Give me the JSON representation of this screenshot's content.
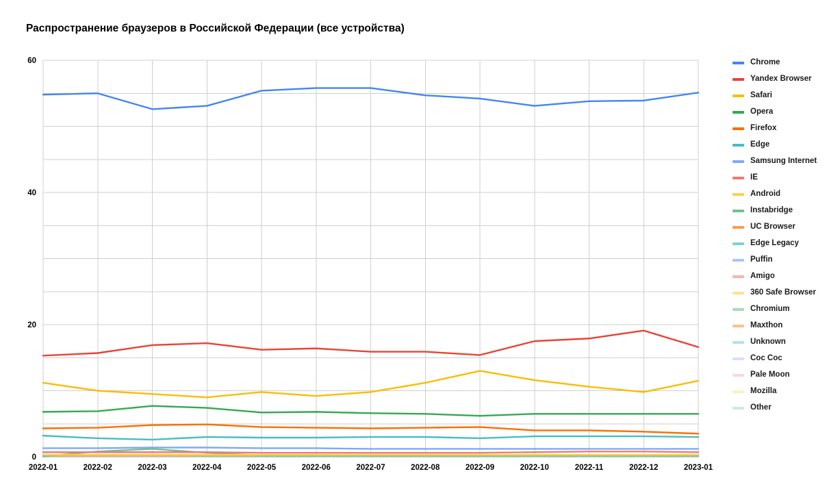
{
  "chart_data": {
    "type": "line",
    "title": "Распространение браузеров в Российской Федерации (все устройства)",
    "xlabel": "",
    "ylabel": "",
    "x": [
      "2022-01",
      "2022-02",
      "2022-03",
      "2022-04",
      "2022-05",
      "2022-06",
      "2022-07",
      "2022-08",
      "2022-09",
      "2022-10",
      "2022-11",
      "2022-12",
      "2023-01"
    ],
    "ylim": [
      0,
      60
    ],
    "yticks": [
      0,
      20,
      40,
      60
    ],
    "ytick_labels": [
      "0",
      "20",
      "40",
      "60"
    ],
    "grid": true,
    "grid_minor_step": 5,
    "legend_position": "right",
    "series": [
      {
        "name": "Chrome",
        "color": "#4285f4",
        "values": [
          54.8,
          55.0,
          52.6,
          53.1,
          55.4,
          55.8,
          55.8,
          54.7,
          54.2,
          53.1,
          53.8,
          53.9,
          55.1
        ]
      },
      {
        "name": "Yandex Browser",
        "color": "#ea4335",
        "values": [
          15.3,
          15.7,
          16.9,
          17.2,
          16.2,
          16.4,
          15.9,
          15.9,
          15.4,
          17.5,
          17.9,
          19.1,
          16.6
        ]
      },
      {
        "name": "Safari",
        "color": "#fbbc04",
        "values": [
          11.2,
          10.0,
          9.5,
          9.0,
          9.8,
          9.2,
          9.8,
          11.2,
          13.0,
          11.6,
          10.6,
          9.8,
          11.5
        ]
      },
      {
        "name": "Opera",
        "color": "#34a853",
        "values": [
          6.8,
          6.9,
          7.7,
          7.4,
          6.7,
          6.8,
          6.6,
          6.5,
          6.2,
          6.5,
          6.5,
          6.5,
          6.5
        ]
      },
      {
        "name": "Firefox",
        "color": "#ff6d01",
        "values": [
          4.3,
          4.4,
          4.8,
          4.9,
          4.5,
          4.4,
          4.3,
          4.4,
          4.5,
          4.0,
          4.0,
          3.8,
          3.5
        ]
      },
      {
        "name": "Edge",
        "color": "#46bdc6",
        "values": [
          3.2,
          2.8,
          2.6,
          3.0,
          2.9,
          2.9,
          3.0,
          3.0,
          2.8,
          3.1,
          3.1,
          3.1,
          3.0
        ]
      },
      {
        "name": "Samsung Internet",
        "color": "#7baaf7",
        "values": [
          1.3,
          1.3,
          1.4,
          1.4,
          1.3,
          1.3,
          1.2,
          1.2,
          1.2,
          1.2,
          1.2,
          1.2,
          1.2
        ]
      },
      {
        "name": "IE",
        "color": "#f07b72",
        "values": [
          0.7,
          0.7,
          0.7,
          0.7,
          0.6,
          0.6,
          0.6,
          0.6,
          0.6,
          0.7,
          0.8,
          0.8,
          0.7
        ]
      },
      {
        "name": "Android",
        "color": "#fcd04f",
        "values": [
          0.3,
          0.3,
          0.3,
          0.3,
          0.3,
          0.3,
          0.3,
          0.3,
          0.3,
          0.3,
          0.3,
          0.3,
          0.3
        ]
      },
      {
        "name": "Instabridge",
        "color": "#71c287",
        "values": [
          0.1,
          0.8,
          1.2,
          0.6,
          0.2,
          0.2,
          0.2,
          0.2,
          0.2,
          0.2,
          0.2,
          0.2,
          0.2
        ]
      },
      {
        "name": "UC Browser",
        "color": "#ff994d",
        "values": [
          0.2,
          0.2,
          0.2,
          0.2,
          0.2,
          0.2,
          0.2,
          0.2,
          0.2,
          0.2,
          0.2,
          0.2,
          0.2
        ]
      },
      {
        "name": "Edge Legacy",
        "color": "#7bd1d8",
        "values": [
          0.2,
          0.2,
          0.2,
          0.1,
          0.1,
          0.1,
          0.1,
          0.1,
          0.1,
          0.1,
          0.1,
          0.1,
          0.1
        ]
      },
      {
        "name": "Puffin",
        "color": "#a8c7fa",
        "values": [
          0.1,
          0.1,
          0.1,
          0.1,
          0.1,
          0.1,
          0.1,
          0.1,
          0.1,
          0.1,
          0.1,
          0.1,
          0.1
        ]
      },
      {
        "name": "Amigo",
        "color": "#f7b4ae",
        "values": [
          0.1,
          0.1,
          0.1,
          0.1,
          0.1,
          0.1,
          0.1,
          0.1,
          0.1,
          0.1,
          0.1,
          0.1,
          0.1
        ]
      },
      {
        "name": "360 Safe Browser",
        "color": "#fde293",
        "values": [
          0.05,
          0.05,
          0.05,
          0.05,
          0.05,
          0.05,
          0.05,
          0.05,
          0.05,
          0.05,
          0.05,
          0.05,
          0.05
        ]
      },
      {
        "name": "Chromium",
        "color": "#a8dcb8",
        "values": [
          0.05,
          0.05,
          0.05,
          0.05,
          0.05,
          0.05,
          0.05,
          0.05,
          0.05,
          0.05,
          0.05,
          0.05,
          0.05
        ]
      },
      {
        "name": "Maxthon",
        "color": "#ffc08a",
        "values": [
          0.04,
          0.04,
          0.04,
          0.04,
          0.04,
          0.04,
          0.04,
          0.04,
          0.04,
          0.04,
          0.04,
          0.04,
          0.04
        ]
      },
      {
        "name": "Unknown",
        "color": "#b3e4e8",
        "values": [
          0.03,
          0.03,
          0.03,
          0.03,
          0.03,
          0.03,
          0.03,
          0.03,
          0.03,
          0.03,
          0.03,
          0.03,
          0.03
        ]
      },
      {
        "name": "Coc Coc",
        "color": "#d3e2fd",
        "values": [
          0.02,
          0.02,
          0.02,
          0.02,
          0.02,
          0.02,
          0.02,
          0.02,
          0.02,
          0.02,
          0.02,
          0.02,
          0.02
        ]
      },
      {
        "name": "Pale Moon",
        "color": "#fbd9d6",
        "values": [
          0.02,
          0.02,
          0.02,
          0.02,
          0.02,
          0.02,
          0.02,
          0.02,
          0.02,
          0.02,
          0.02,
          0.02,
          0.02
        ]
      },
      {
        "name": "Mozilla",
        "color": "#feefc3",
        "values": [
          0.01,
          0.01,
          0.01,
          0.01,
          0.01,
          0.01,
          0.01,
          0.01,
          0.01,
          0.01,
          0.01,
          0.01,
          0.01
        ]
      },
      {
        "name": "Other",
        "color": "#ccecd7",
        "values": [
          0.01,
          0.01,
          0.01,
          0.01,
          0.01,
          0.01,
          0.01,
          0.01,
          0.01,
          0.01,
          0.01,
          0.01,
          0.01
        ]
      }
    ]
  },
  "legend": {
    "items": [
      {
        "label": "Chrome"
      },
      {
        "label": "Yandex Browser"
      },
      {
        "label": "Safari"
      },
      {
        "label": "Opera"
      },
      {
        "label": "Firefox"
      },
      {
        "label": "Edge"
      },
      {
        "label": "Samsung Internet"
      },
      {
        "label": "IE"
      },
      {
        "label": "Android"
      },
      {
        "label": "Instabridge"
      },
      {
        "label": "UC Browser"
      },
      {
        "label": "Edge Legacy"
      },
      {
        "label": "Puffin"
      },
      {
        "label": "Amigo"
      },
      {
        "label": "360 Safe Browser"
      },
      {
        "label": "Chromium"
      },
      {
        "label": "Maxthon"
      },
      {
        "label": "Unknown"
      },
      {
        "label": "Coc Coc"
      },
      {
        "label": "Pale Moon"
      },
      {
        "label": "Mozilla"
      },
      {
        "label": "Other"
      }
    ]
  }
}
